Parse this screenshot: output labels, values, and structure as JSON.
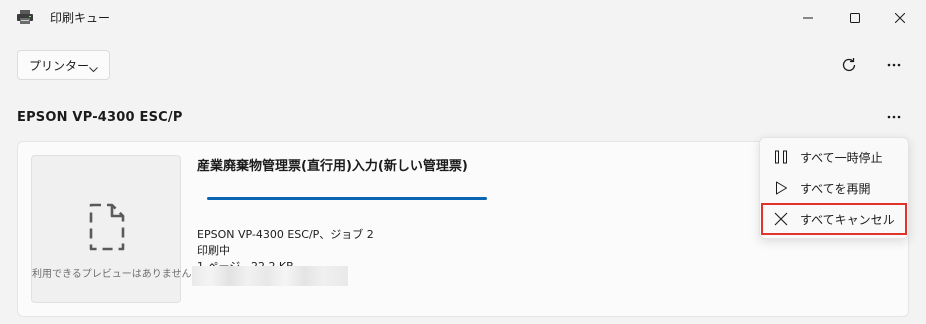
{
  "window": {
    "title": "印刷キュー"
  },
  "toolbar": {
    "printer_selector_label": "プリンター"
  },
  "printer": {
    "name": "EPSON VP-4300 ESC/P"
  },
  "job": {
    "preview_unavailable": "利用できるプレビューはありません",
    "title": "産業廃棄物管理票(直行用)入力(新しい管理票)",
    "progress": 1.0,
    "printer_job": "EPSON VP-4300 ESC/P、ジョブ 2",
    "status": "印刷中",
    "pages_size": "1 ページ、22.2 KB"
  },
  "context_menu": {
    "items": [
      {
        "label": "すべて一時停止",
        "icon": "pause-icon"
      },
      {
        "label": "すべてを再開",
        "icon": "play-icon"
      },
      {
        "label": "すべてキャンセル",
        "icon": "close-icon"
      }
    ]
  },
  "colors": {
    "progress": "#0a64b4",
    "highlight_border": "#e0332c"
  }
}
